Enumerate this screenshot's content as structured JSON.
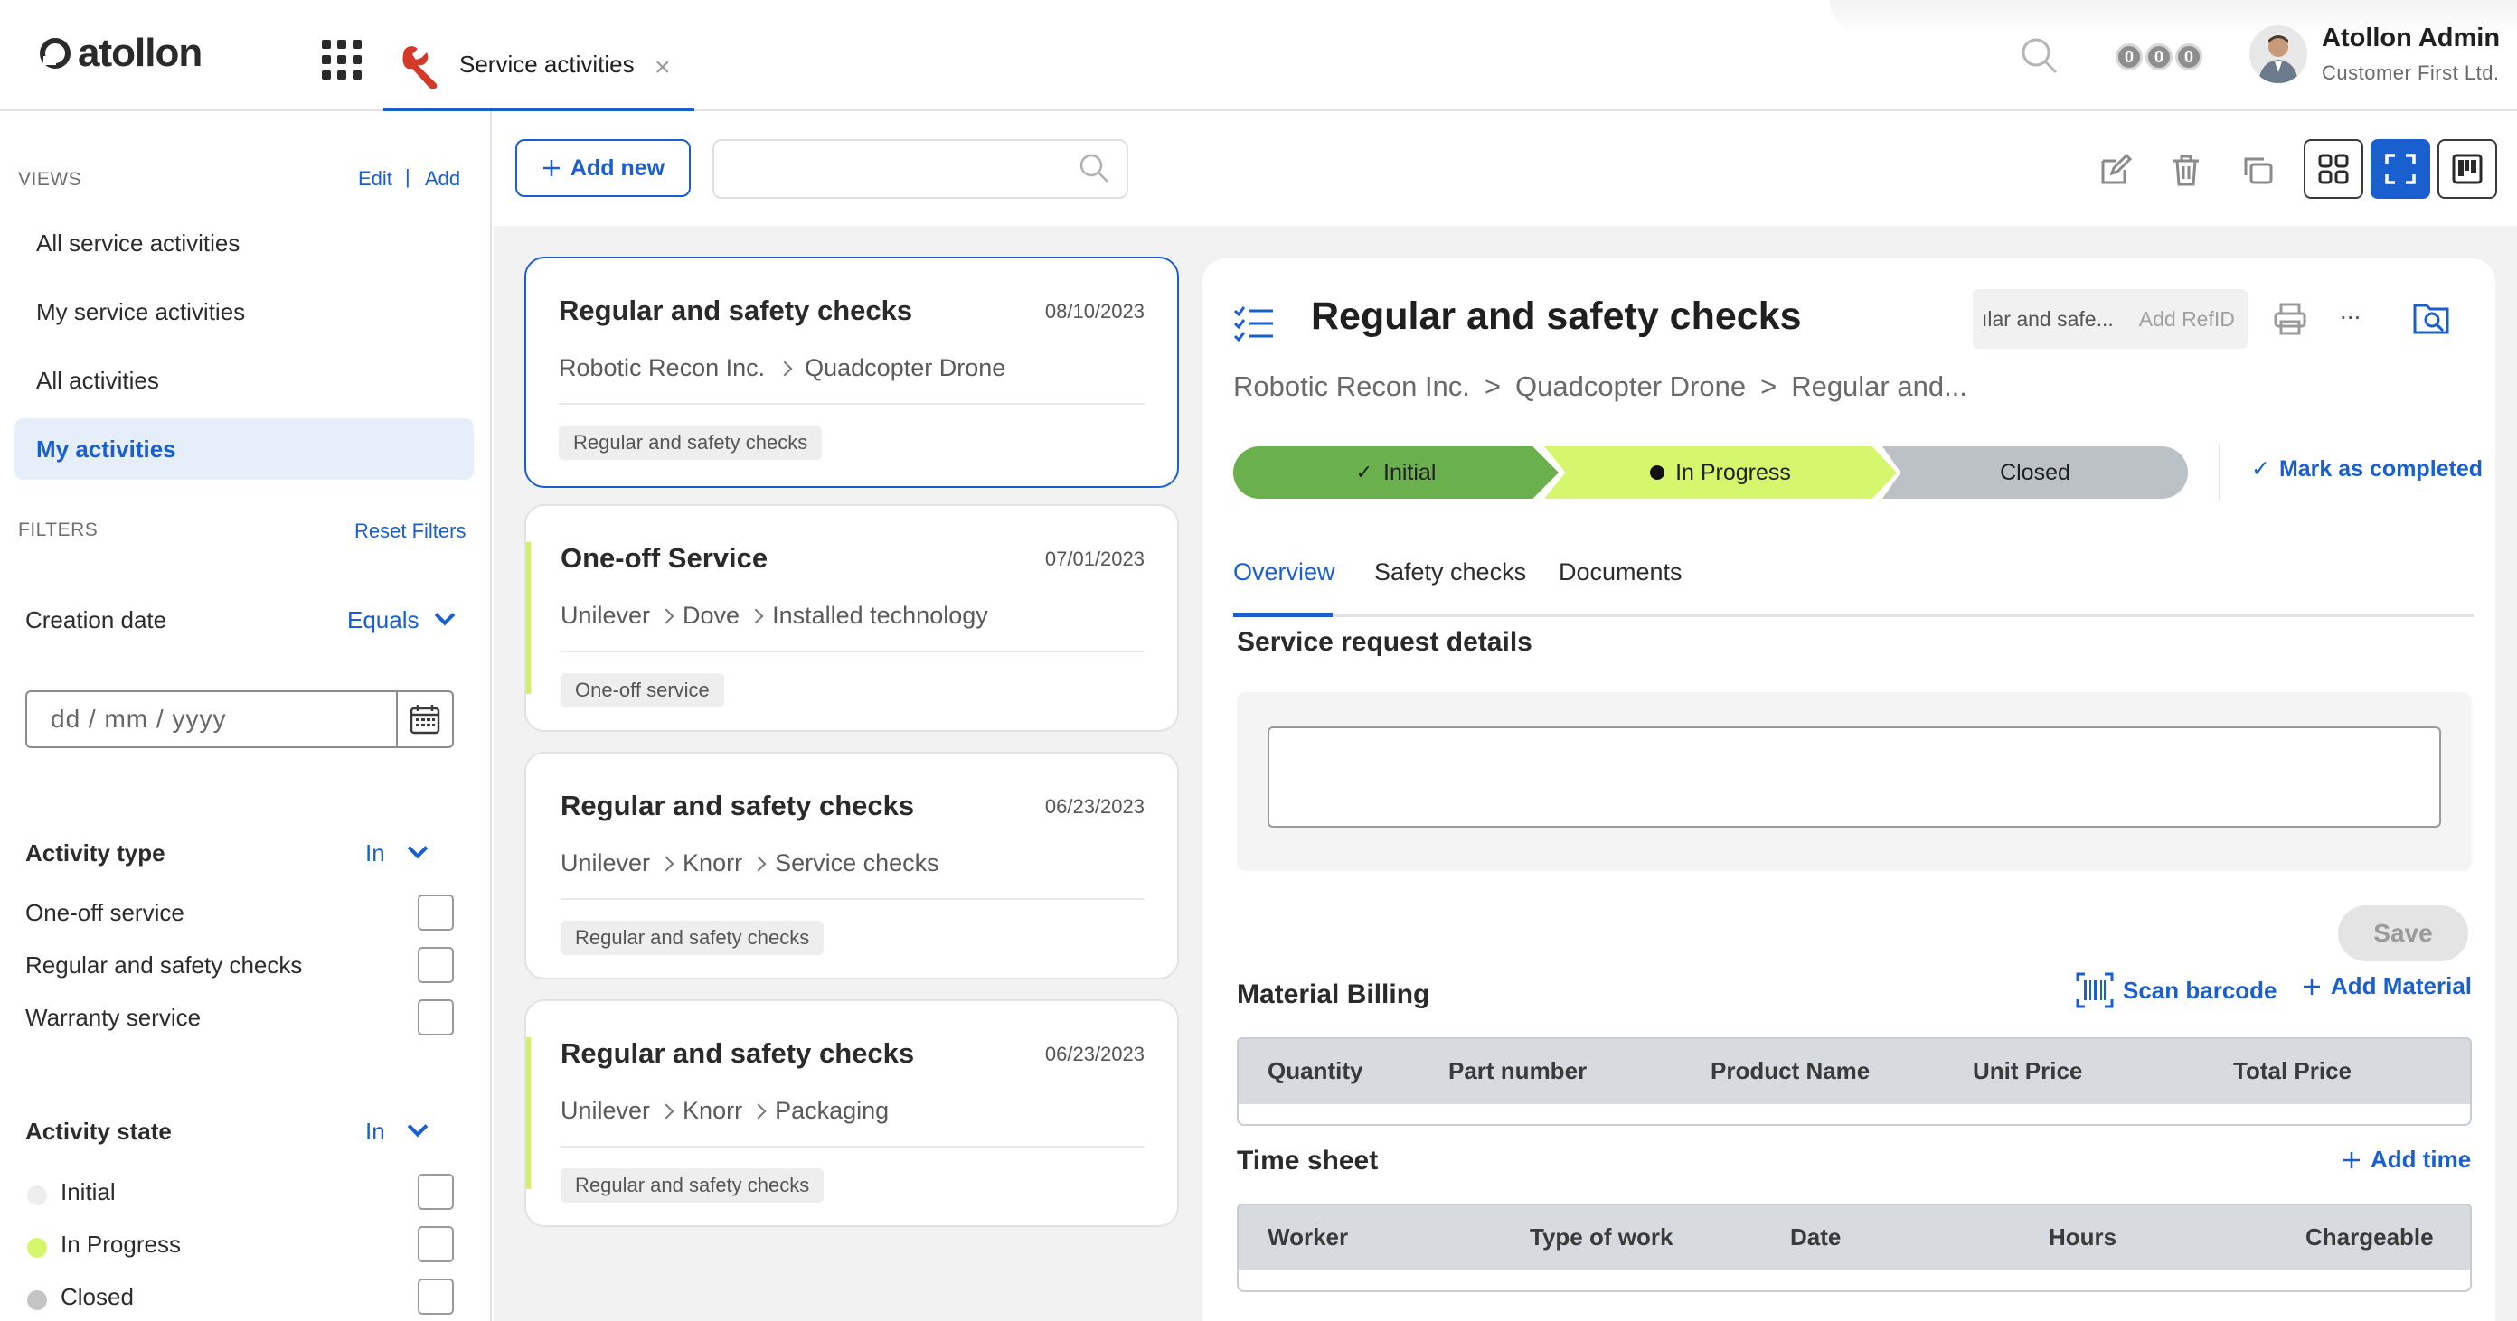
{
  "header": {
    "logo_text": "atollon",
    "tab_label": "Service activities",
    "tab_close": "×",
    "notifications": [
      "0",
      "0",
      "0"
    ],
    "user_name": "Atollon Admin",
    "user_company": "Customer First Ltd."
  },
  "sidebar": {
    "views_heading": "VIEWS",
    "edit_label": "Edit",
    "sep": "|",
    "add_label": "Add",
    "views": [
      {
        "label": "All service activities",
        "active": false
      },
      {
        "label": "My service activities",
        "active": false
      },
      {
        "label": "All activities",
        "active": false
      },
      {
        "label": "My activities",
        "active": true
      }
    ],
    "filters_heading": "FILTERS",
    "reset_label": "Reset Filters",
    "creation_date": {
      "label": "Creation date",
      "operator": "Equals",
      "placeholder": "dd / mm / yyyy"
    },
    "activity_type": {
      "label": "Activity type",
      "operator": "In",
      "options": [
        "One-off service",
        "Regular and safety checks",
        "Warranty service"
      ]
    },
    "activity_state": {
      "label": "Activity state",
      "operator": "In",
      "options": [
        {
          "label": "Initial",
          "color": "#eeeeee"
        },
        {
          "label": "In Progress",
          "color": "#d6f76d"
        },
        {
          "label": "Closed",
          "color": "#c4c4c4"
        }
      ]
    }
  },
  "toolbar": {
    "add_new_label": "Add new",
    "search_value": ""
  },
  "cards": [
    {
      "title": "Regular and safety checks",
      "date": "08/10/2023",
      "crumbs": [
        "Robotic Recon Inc.",
        "Quadcopter Drone"
      ],
      "tag": "Regular and safety checks"
    },
    {
      "title": "One-off Service",
      "date": "07/01/2023",
      "crumbs": [
        "Unilever",
        "Dove",
        "Installed technology"
      ],
      "tag": "One-off service"
    },
    {
      "title": "Regular and safety checks",
      "date": "06/23/2023",
      "crumbs": [
        "Unilever",
        "Knorr",
        "Service checks"
      ],
      "tag": "Regular and safety checks"
    },
    {
      "title": "Regular and safety checks",
      "date": "06/23/2023",
      "crumbs": [
        "Unilever",
        "Knorr",
        "Packaging"
      ],
      "tag": "Regular and safety checks"
    }
  ],
  "detail": {
    "title": "Regular and safety checks",
    "refid_value": "ılar and safe...",
    "refid_placeholder": "Add RefID",
    "more_label": "...",
    "crumbs": [
      "Robotic Recon Inc.",
      ">",
      "Quadcopter Drone",
      ">",
      "Regular and..."
    ],
    "stages": [
      {
        "label": "Initial",
        "state": "done"
      },
      {
        "label": "In Progress",
        "state": "current"
      },
      {
        "label": "Closed",
        "state": "pending"
      }
    ],
    "mark_completed": "Mark as completed",
    "tabs": [
      "Overview",
      "Safety checks",
      "Documents"
    ],
    "service_request_title": "Service request details",
    "service_request_value": "",
    "save_label": "Save",
    "material_billing": {
      "title": "Material Billing",
      "scan_label": "Scan barcode",
      "add_label": "Add Material",
      "columns": [
        "Quantity",
        "Part number",
        "Product Name",
        "Unit Price",
        "Total Price"
      ]
    },
    "time_sheet": {
      "title": "Time sheet",
      "add_label": "Add time",
      "columns": [
        "Worker",
        "Type of work",
        "Date",
        "Hours",
        "Chargeable"
      ]
    }
  }
}
